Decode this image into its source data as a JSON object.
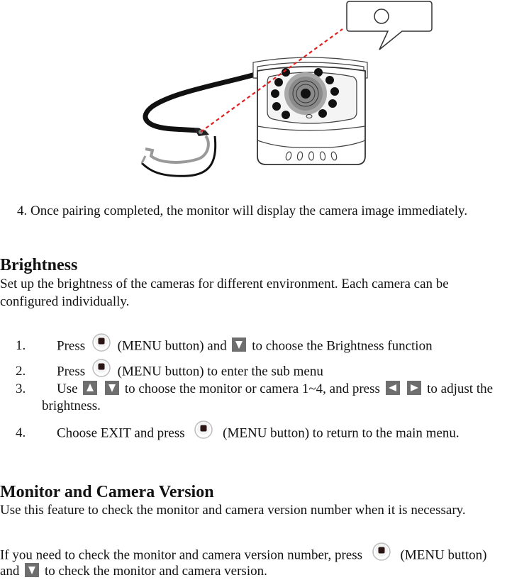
{
  "illustration": {
    "label": "camera-pairing-illustration",
    "accent_color": "#e02020"
  },
  "step4_pairing": "4. Once pairing completed, the monitor will display the camera image immediately.",
  "brightness": {
    "title": "Brightness",
    "description_line1": "Set up the brightness of the cameras for different environment. Each camera can be",
    "description_line2": "configured individually.",
    "steps": [
      {
        "number": "1.",
        "parts": [
          "Press",
          "(MENU button) and",
          "to choose the Brightness function"
        ]
      },
      {
        "number": "2.",
        "parts": [
          "Press",
          "(MENU button) to enter the sub menu"
        ]
      },
      {
        "number": "3.",
        "parts": [
          "Use",
          "to choose the monitor or camera 1~4, and press",
          "to adjust the"
        ],
        "continuation": "brightness."
      },
      {
        "number": "4.",
        "parts": [
          "Choose EXIT and press",
          "(MENU button) to return to the main menu."
        ]
      }
    ]
  },
  "version": {
    "title": "Monitor and Camera Version",
    "description": "Use this feature to check the monitor and camera version number when it is necessary.",
    "instruction_line1_a": "If you need to check the monitor and camera version number, press",
    "instruction_line1_b": "(MENU button)",
    "instruction_line2_a": "and",
    "instruction_line2_b": "to check the monitor and camera version."
  },
  "icons": {
    "menu": "menu-button-icon",
    "up": "arrow-up-icon",
    "down": "arrow-down-icon",
    "left": "arrow-left-icon",
    "right": "arrow-right-icon"
  }
}
